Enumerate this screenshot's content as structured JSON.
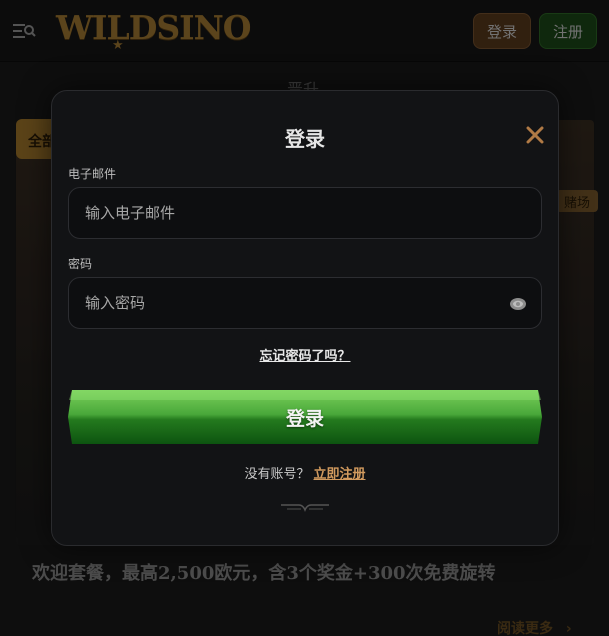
{
  "header": {
    "logo_text": "WILDSINO",
    "login_label": "登录",
    "register_label": "注册"
  },
  "background": {
    "top_title": "晋升",
    "tab_label": "全部",
    "side_tag": "赌场",
    "promo_text": "欢迎套餐，最高2,500欧元，含3个奖金+300次免费旋转",
    "read_more": "阅读更多"
  },
  "modal": {
    "title": "登录",
    "email": {
      "label": "电子邮件",
      "placeholder": "输入电子邮件",
      "value": ""
    },
    "password": {
      "label": "密码",
      "placeholder": "输入密码",
      "value": ""
    },
    "forgot_label": "忘记密码了吗？",
    "submit_label": "登录",
    "no_account_text": "没有账号？",
    "register_link": "立即注册"
  },
  "colors": {
    "accent_gold": "#a67c33",
    "button_green": "#3f9a2f",
    "register_link": "#d19a5e"
  },
  "icons": {
    "menu": "menu-search-icon",
    "close": "close-icon",
    "eye": "eye-icon",
    "ornament": "divider-ornament-icon",
    "chevron": "chevron-right-icon"
  }
}
